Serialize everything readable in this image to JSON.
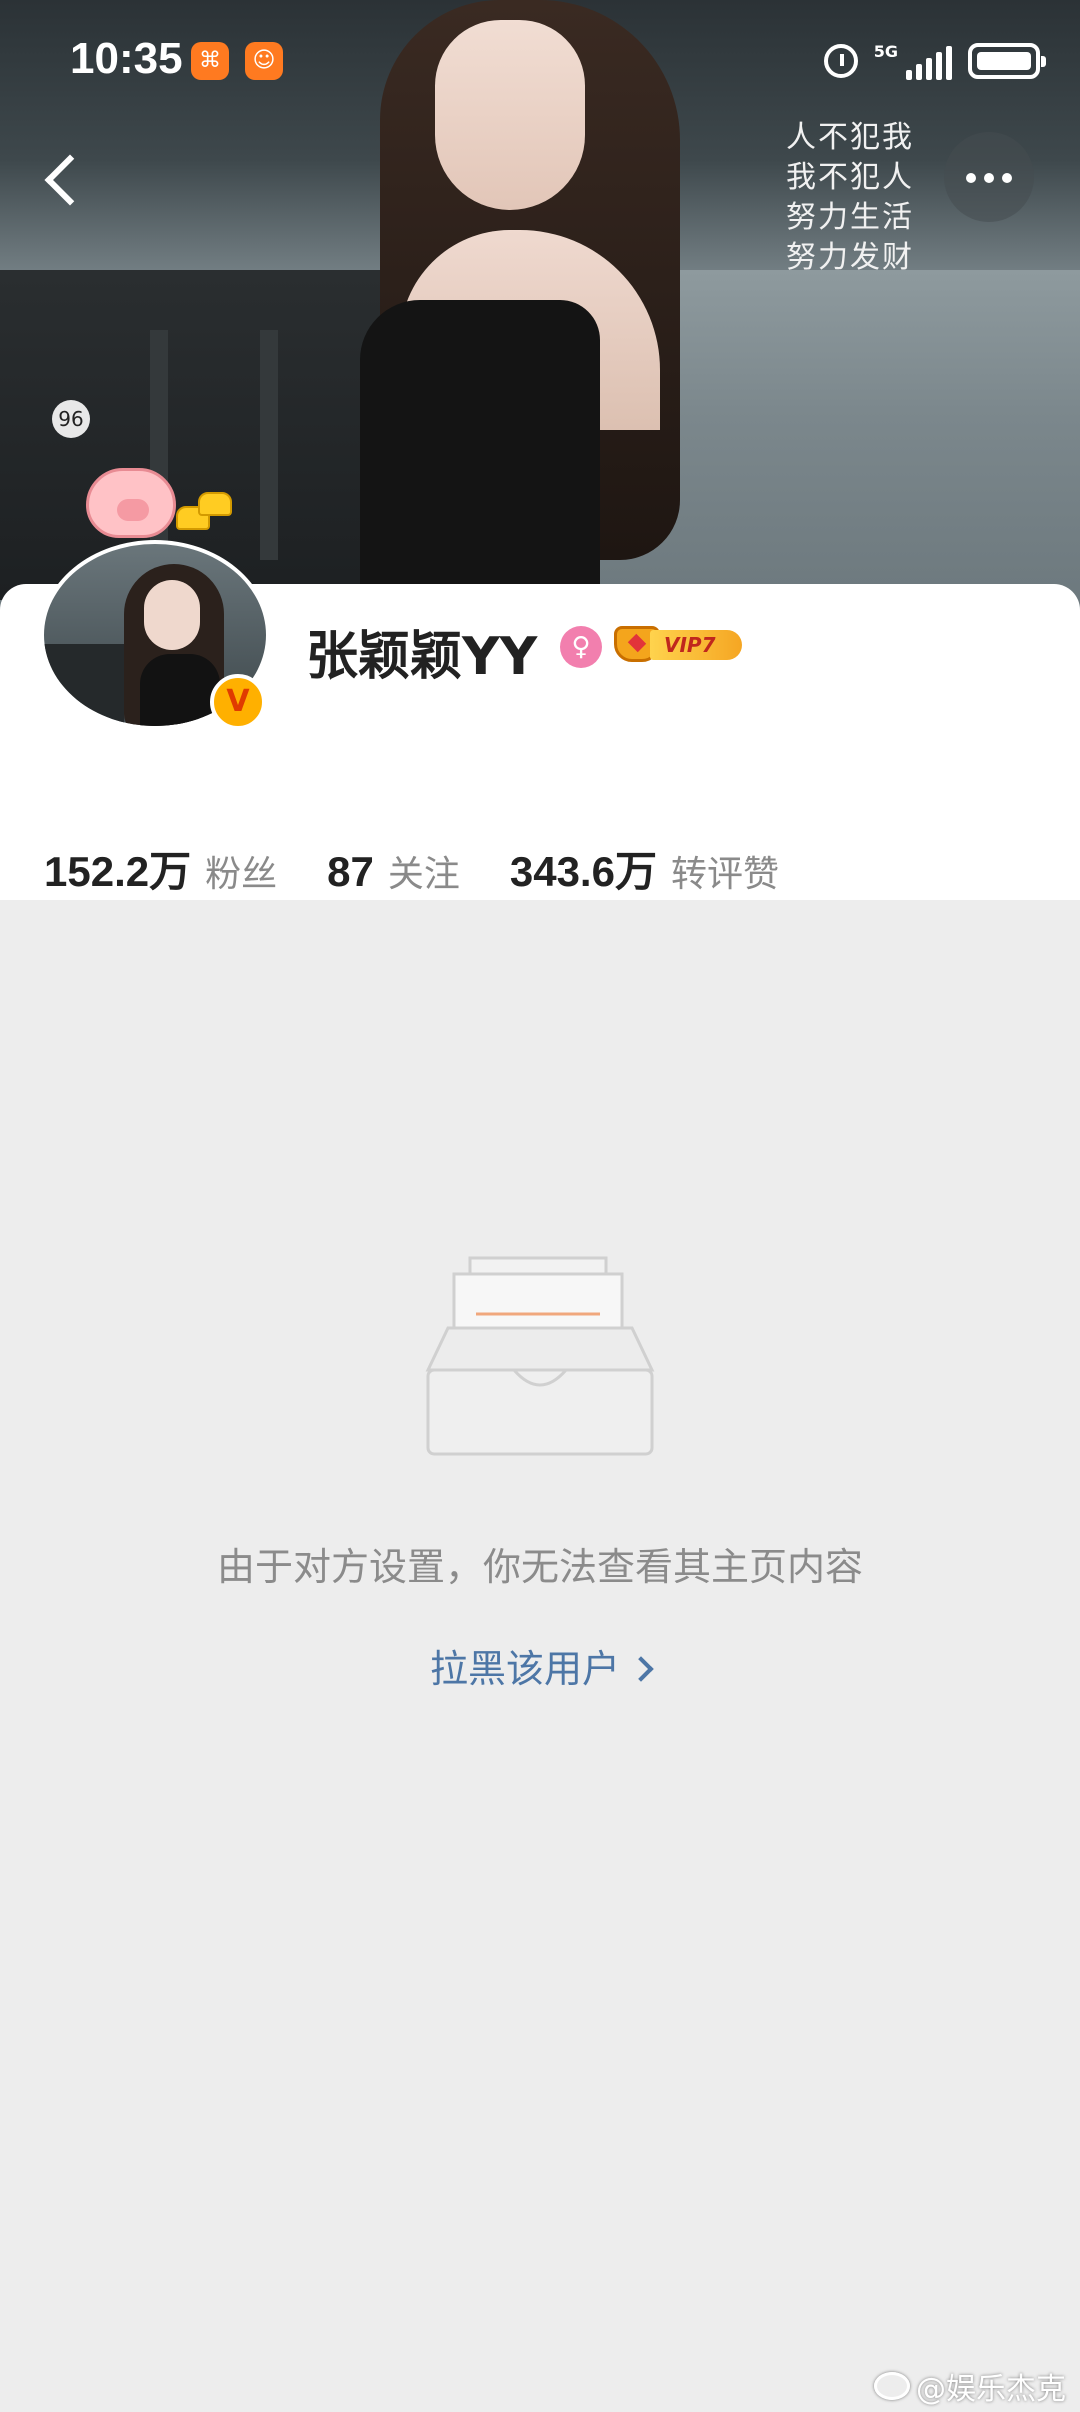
{
  "status_bar": {
    "time": "10:35",
    "network_label": "5G"
  },
  "cover": {
    "overlay_text": [
      "人不犯我",
      "我不犯人",
      "努力生活",
      "努力发财"
    ],
    "boat_sign": "96"
  },
  "profile": {
    "username": "张颖颖YY",
    "vip_label": "VIP7",
    "verified_mark": "V",
    "stats": [
      {
        "value": "152.2万",
        "label": "粉丝"
      },
      {
        "value": "87",
        "label": "关注"
      },
      {
        "value": "343.6万",
        "label": "转评赞"
      }
    ]
  },
  "empty_state": {
    "message": "由于对方设置，你无法查看其主页内容",
    "block_link": "拉黑该用户"
  },
  "watermark": {
    "text": "@娱乐杰克"
  },
  "colors": {
    "link": "#4d76a6",
    "muted_text": "#8b8b8b",
    "background": "#ededed"
  }
}
